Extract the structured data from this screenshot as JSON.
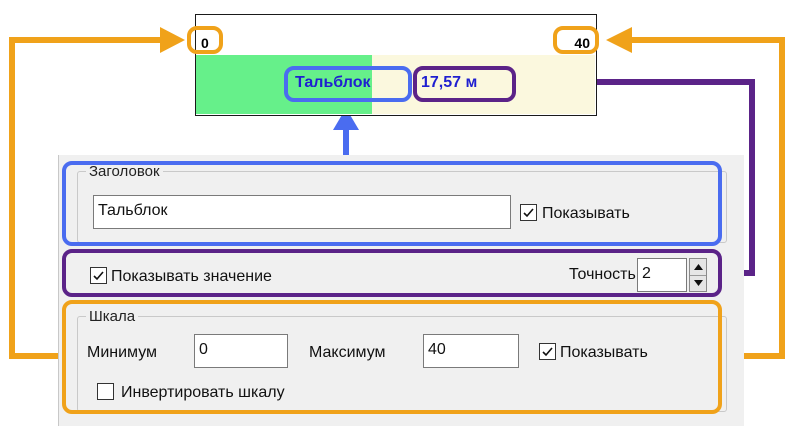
{
  "preview": {
    "scale_min": "0",
    "scale_max": "40",
    "title": "Тальблок",
    "value": "17,57 м",
    "fill_fraction": 0.44
  },
  "title_group": {
    "legend": "Заголовок",
    "title_value": "Тальблок",
    "show_label": "Показывать",
    "show_checked": true
  },
  "value_group": {
    "show_value_label": "Показывать значение",
    "show_value_checked": true,
    "precision_label": "Точность",
    "precision_value": "2"
  },
  "scale_group": {
    "legend": "Шкала",
    "min_label": "Минимум",
    "min_value": "0",
    "max_label": "Максимум",
    "max_value": "40",
    "show_label": "Показывать",
    "show_checked": true,
    "invert_label": "Инвертировать шкалу",
    "invert_checked": false
  },
  "colors": {
    "title_highlight": "#4a6cf0",
    "value_highlight": "#5b2388",
    "scale_highlight": "#f0a21a",
    "fill_green": "#66f08a",
    "text_blue": "#1f1fd0"
  }
}
